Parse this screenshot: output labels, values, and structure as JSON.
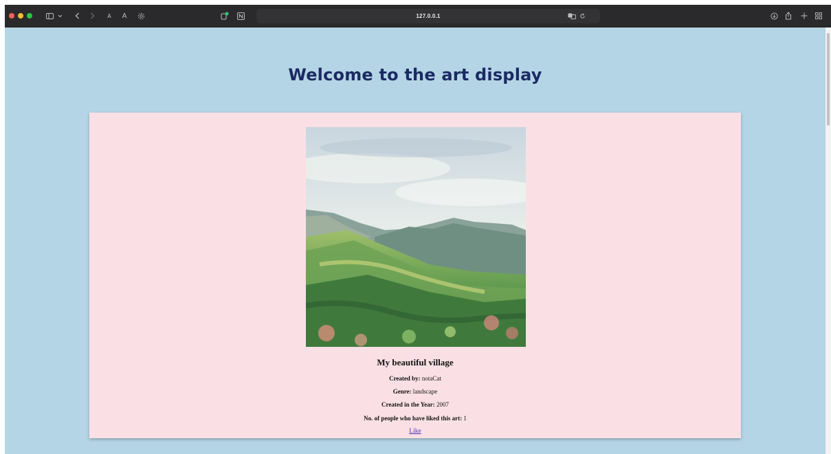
{
  "browser": {
    "url": "127.0.0.1",
    "colors": {
      "toolbar": "#2a2a2c",
      "close": "#ff5f57",
      "minimize": "#febc2e",
      "zoom": "#28c840"
    },
    "icons": {
      "sidebar": "sidebar-icon",
      "back": "chevron-left-icon",
      "forward": "chevron-right-icon",
      "settings": "gear-icon",
      "translate": "translate-icon",
      "reload": "reload-icon",
      "download": "download-icon",
      "share": "share-icon",
      "new_tab": "plus-icon",
      "tab_overview": "grid-icon"
    },
    "text_smaller": "A",
    "text_larger": "A"
  },
  "page": {
    "background": "#b4d5e6",
    "title": "Welcome to the art display",
    "title_color": "#1c2a63"
  },
  "art": {
    "card_background": "#fae0e5",
    "title": "My beautiful village",
    "created_by_label": "Created by:",
    "created_by": "notaCat",
    "genre_label": "Genre:",
    "genre": "landscape",
    "year_label": "Created in the Year:",
    "year": "2007",
    "likes_label": "No. of people who have liked this art:",
    "likes": "1",
    "like_button": "Like",
    "link_color": "#4b2fb6"
  }
}
